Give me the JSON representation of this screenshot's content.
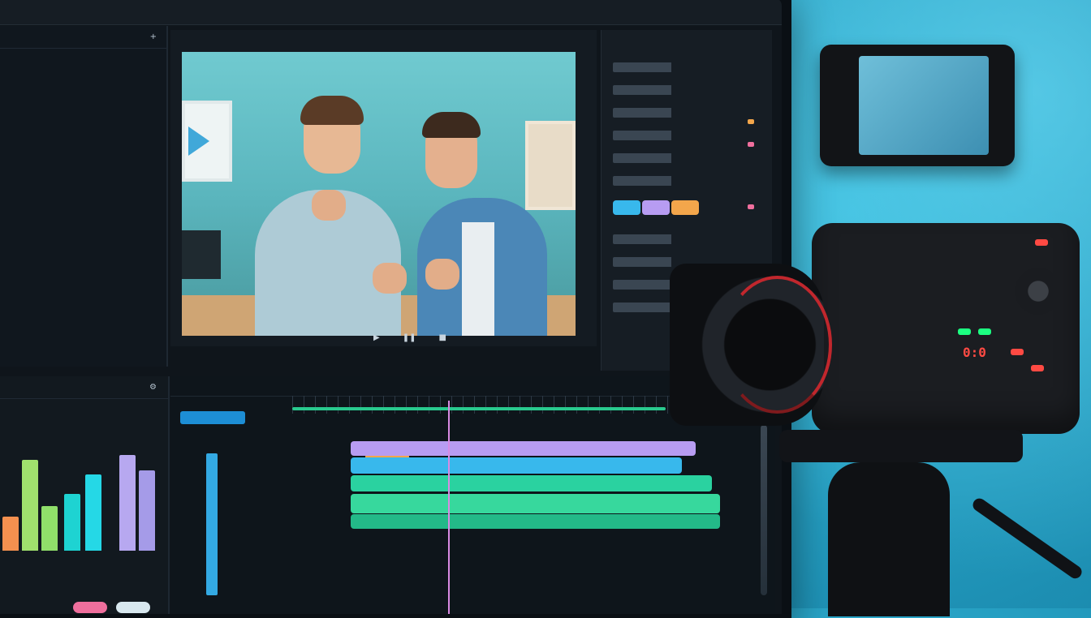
{
  "colors": {
    "accent_blue": "#1d8ed5",
    "accent_green": "#29c98e",
    "accent_purple": "#b79cf2",
    "accent_orange": "#f3a64b",
    "accent_pink": "#ef6f9d",
    "accent_red": "#ff4a43"
  },
  "icons": {
    "play": "play-icon",
    "pause": "pause-icon",
    "settings": "gear-icon"
  },
  "editor": {
    "top_tabs": [
      "",
      "",
      "",
      "",
      ""
    ],
    "left_panel_title": "",
    "viewer_label": "",
    "transport": [
      "",
      "",
      ""
    ],
    "timeline_tabs": [
      "",
      "",
      ""
    ],
    "clip_colors": [
      "#f3a64b",
      "#b79cf2",
      "#38b8ec",
      "#2ad2a0",
      "#37d89d"
    ],
    "meter_values": [
      0.32,
      0.86,
      0.42,
      0.54,
      0.72,
      0.91,
      0.76
    ],
    "meter_colors": [
      "#f4904f",
      "#a0e06d",
      "#90df6a",
      "#1ed3d2",
      "#25d8e6",
      "#b7a8f0",
      "#a59be8"
    ]
  },
  "camera": {
    "display_text": "0:0"
  }
}
